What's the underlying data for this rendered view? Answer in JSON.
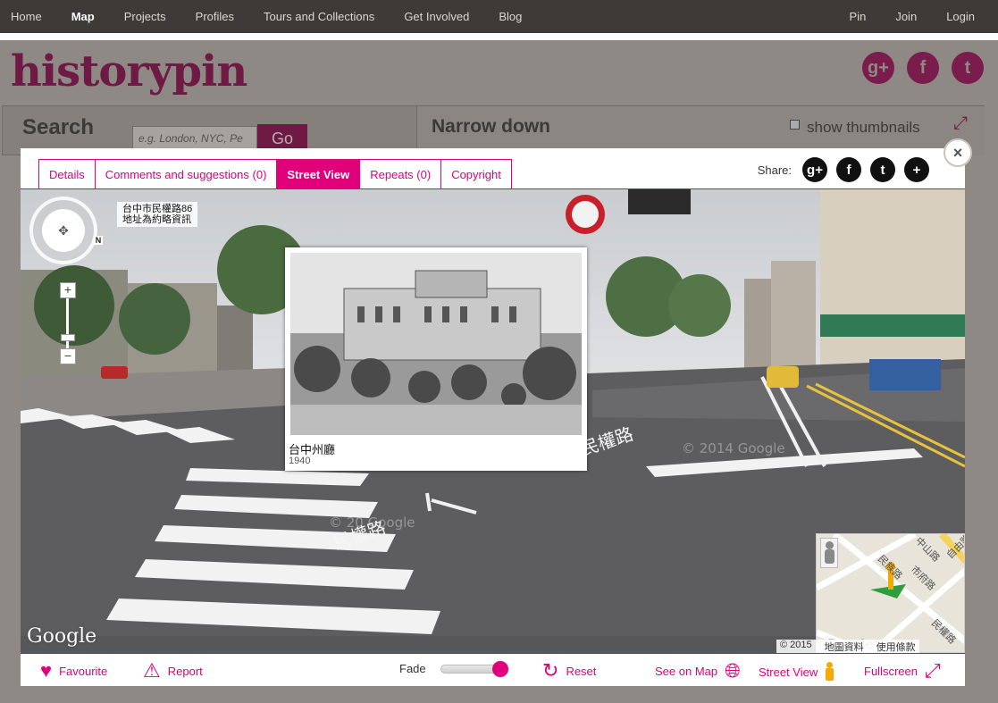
{
  "nav": {
    "left": [
      "Home",
      "Map",
      "Projects",
      "Profiles",
      "Tours and Collections",
      "Get Involved",
      "Blog"
    ],
    "active": "Map",
    "right": [
      "Pin",
      "Join",
      "Login"
    ]
  },
  "background": {
    "logo": "historypin",
    "search_label": "Search",
    "search_placeholder": "e.g. London, NYC, Pe",
    "go_label": "Go",
    "narrow_label": "Narrow down",
    "show_thumbnails": "show thumbnails",
    "social": [
      "g+",
      "f",
      "t"
    ]
  },
  "modal": {
    "close": "×",
    "tabs": [
      "Details",
      "Comments and suggestions (0)",
      "Street View",
      "Repeats (0)",
      "Copyright"
    ],
    "active_tab": "Street View",
    "share_label": "Share:",
    "share_icons": [
      "google-plus-icon",
      "facebook-icon",
      "twitter-icon",
      "add-icon"
    ]
  },
  "streetview": {
    "address_line1": "台中市民權路86",
    "address_line2": "地址為約略資訊",
    "compass_label": "N",
    "zoom_in": "+",
    "zoom_out": "−",
    "road_label_1": "民權路",
    "road_label_2": "民權路",
    "watermark_1": "© 2014 Google",
    "watermark_2": "© 20  Google",
    "google_logo": "Google",
    "photo_title": "台中州廳",
    "photo_year": "1940",
    "minimap": {
      "copyright": "© 2015",
      "map_data": "地圖資料",
      "terms": "使用條款",
      "watermark": "Google",
      "streets": [
        "民族路",
        "市府路",
        "中山路",
        "自由路",
        "民權路"
      ]
    }
  },
  "footer": {
    "favourite": "Favourite",
    "report": "Report",
    "fade": "Fade",
    "fade_value": 0.9,
    "reset": "Reset",
    "see_on_map": "See on Map",
    "street_view": "Street View",
    "fullscreen": "Fullscreen"
  },
  "colors": {
    "accent": "#e0007a",
    "nav_bg": "#3e3a37",
    "logo": "#6e1a45"
  }
}
